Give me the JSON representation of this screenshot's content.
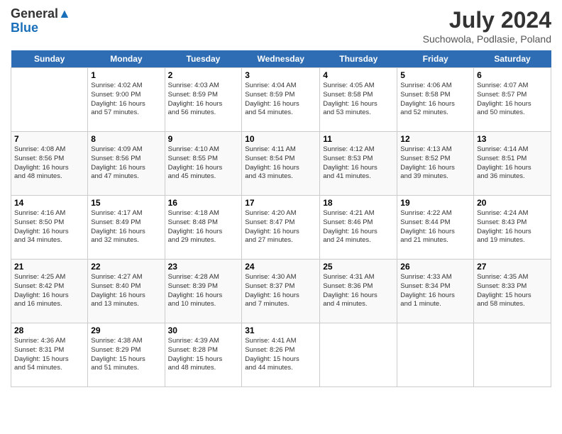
{
  "header": {
    "logo_line1": "General",
    "logo_line2": "Blue",
    "title": "July 2024",
    "subtitle": "Suchowola, Podlasie, Poland"
  },
  "columns": [
    "Sunday",
    "Monday",
    "Tuesday",
    "Wednesday",
    "Thursday",
    "Friday",
    "Saturday"
  ],
  "weeks": [
    [
      {
        "day": "",
        "info": ""
      },
      {
        "day": "1",
        "info": "Sunrise: 4:02 AM\nSunset: 9:00 PM\nDaylight: 16 hours\nand 57 minutes."
      },
      {
        "day": "2",
        "info": "Sunrise: 4:03 AM\nSunset: 8:59 PM\nDaylight: 16 hours\nand 56 minutes."
      },
      {
        "day": "3",
        "info": "Sunrise: 4:04 AM\nSunset: 8:59 PM\nDaylight: 16 hours\nand 54 minutes."
      },
      {
        "day": "4",
        "info": "Sunrise: 4:05 AM\nSunset: 8:58 PM\nDaylight: 16 hours\nand 53 minutes."
      },
      {
        "day": "5",
        "info": "Sunrise: 4:06 AM\nSunset: 8:58 PM\nDaylight: 16 hours\nand 52 minutes."
      },
      {
        "day": "6",
        "info": "Sunrise: 4:07 AM\nSunset: 8:57 PM\nDaylight: 16 hours\nand 50 minutes."
      }
    ],
    [
      {
        "day": "7",
        "info": "Sunrise: 4:08 AM\nSunset: 8:56 PM\nDaylight: 16 hours\nand 48 minutes."
      },
      {
        "day": "8",
        "info": "Sunrise: 4:09 AM\nSunset: 8:56 PM\nDaylight: 16 hours\nand 47 minutes."
      },
      {
        "day": "9",
        "info": "Sunrise: 4:10 AM\nSunset: 8:55 PM\nDaylight: 16 hours\nand 45 minutes."
      },
      {
        "day": "10",
        "info": "Sunrise: 4:11 AM\nSunset: 8:54 PM\nDaylight: 16 hours\nand 43 minutes."
      },
      {
        "day": "11",
        "info": "Sunrise: 4:12 AM\nSunset: 8:53 PM\nDaylight: 16 hours\nand 41 minutes."
      },
      {
        "day": "12",
        "info": "Sunrise: 4:13 AM\nSunset: 8:52 PM\nDaylight: 16 hours\nand 39 minutes."
      },
      {
        "day": "13",
        "info": "Sunrise: 4:14 AM\nSunset: 8:51 PM\nDaylight: 16 hours\nand 36 minutes."
      }
    ],
    [
      {
        "day": "14",
        "info": "Sunrise: 4:16 AM\nSunset: 8:50 PM\nDaylight: 16 hours\nand 34 minutes."
      },
      {
        "day": "15",
        "info": "Sunrise: 4:17 AM\nSunset: 8:49 PM\nDaylight: 16 hours\nand 32 minutes."
      },
      {
        "day": "16",
        "info": "Sunrise: 4:18 AM\nSunset: 8:48 PM\nDaylight: 16 hours\nand 29 minutes."
      },
      {
        "day": "17",
        "info": "Sunrise: 4:20 AM\nSunset: 8:47 PM\nDaylight: 16 hours\nand 27 minutes."
      },
      {
        "day": "18",
        "info": "Sunrise: 4:21 AM\nSunset: 8:46 PM\nDaylight: 16 hours\nand 24 minutes."
      },
      {
        "day": "19",
        "info": "Sunrise: 4:22 AM\nSunset: 8:44 PM\nDaylight: 16 hours\nand 21 minutes."
      },
      {
        "day": "20",
        "info": "Sunrise: 4:24 AM\nSunset: 8:43 PM\nDaylight: 16 hours\nand 19 minutes."
      }
    ],
    [
      {
        "day": "21",
        "info": "Sunrise: 4:25 AM\nSunset: 8:42 PM\nDaylight: 16 hours\nand 16 minutes."
      },
      {
        "day": "22",
        "info": "Sunrise: 4:27 AM\nSunset: 8:40 PM\nDaylight: 16 hours\nand 13 minutes."
      },
      {
        "day": "23",
        "info": "Sunrise: 4:28 AM\nSunset: 8:39 PM\nDaylight: 16 hours\nand 10 minutes."
      },
      {
        "day": "24",
        "info": "Sunrise: 4:30 AM\nSunset: 8:37 PM\nDaylight: 16 hours\nand 7 minutes."
      },
      {
        "day": "25",
        "info": "Sunrise: 4:31 AM\nSunset: 8:36 PM\nDaylight: 16 hours\nand 4 minutes."
      },
      {
        "day": "26",
        "info": "Sunrise: 4:33 AM\nSunset: 8:34 PM\nDaylight: 16 hours\nand 1 minute."
      },
      {
        "day": "27",
        "info": "Sunrise: 4:35 AM\nSunset: 8:33 PM\nDaylight: 15 hours\nand 58 minutes."
      }
    ],
    [
      {
        "day": "28",
        "info": "Sunrise: 4:36 AM\nSunset: 8:31 PM\nDaylight: 15 hours\nand 54 minutes."
      },
      {
        "day": "29",
        "info": "Sunrise: 4:38 AM\nSunset: 8:29 PM\nDaylight: 15 hours\nand 51 minutes."
      },
      {
        "day": "30",
        "info": "Sunrise: 4:39 AM\nSunset: 8:28 PM\nDaylight: 15 hours\nand 48 minutes."
      },
      {
        "day": "31",
        "info": "Sunrise: 4:41 AM\nSunset: 8:26 PM\nDaylight: 15 hours\nand 44 minutes."
      },
      {
        "day": "",
        "info": ""
      },
      {
        "day": "",
        "info": ""
      },
      {
        "day": "",
        "info": ""
      }
    ]
  ]
}
